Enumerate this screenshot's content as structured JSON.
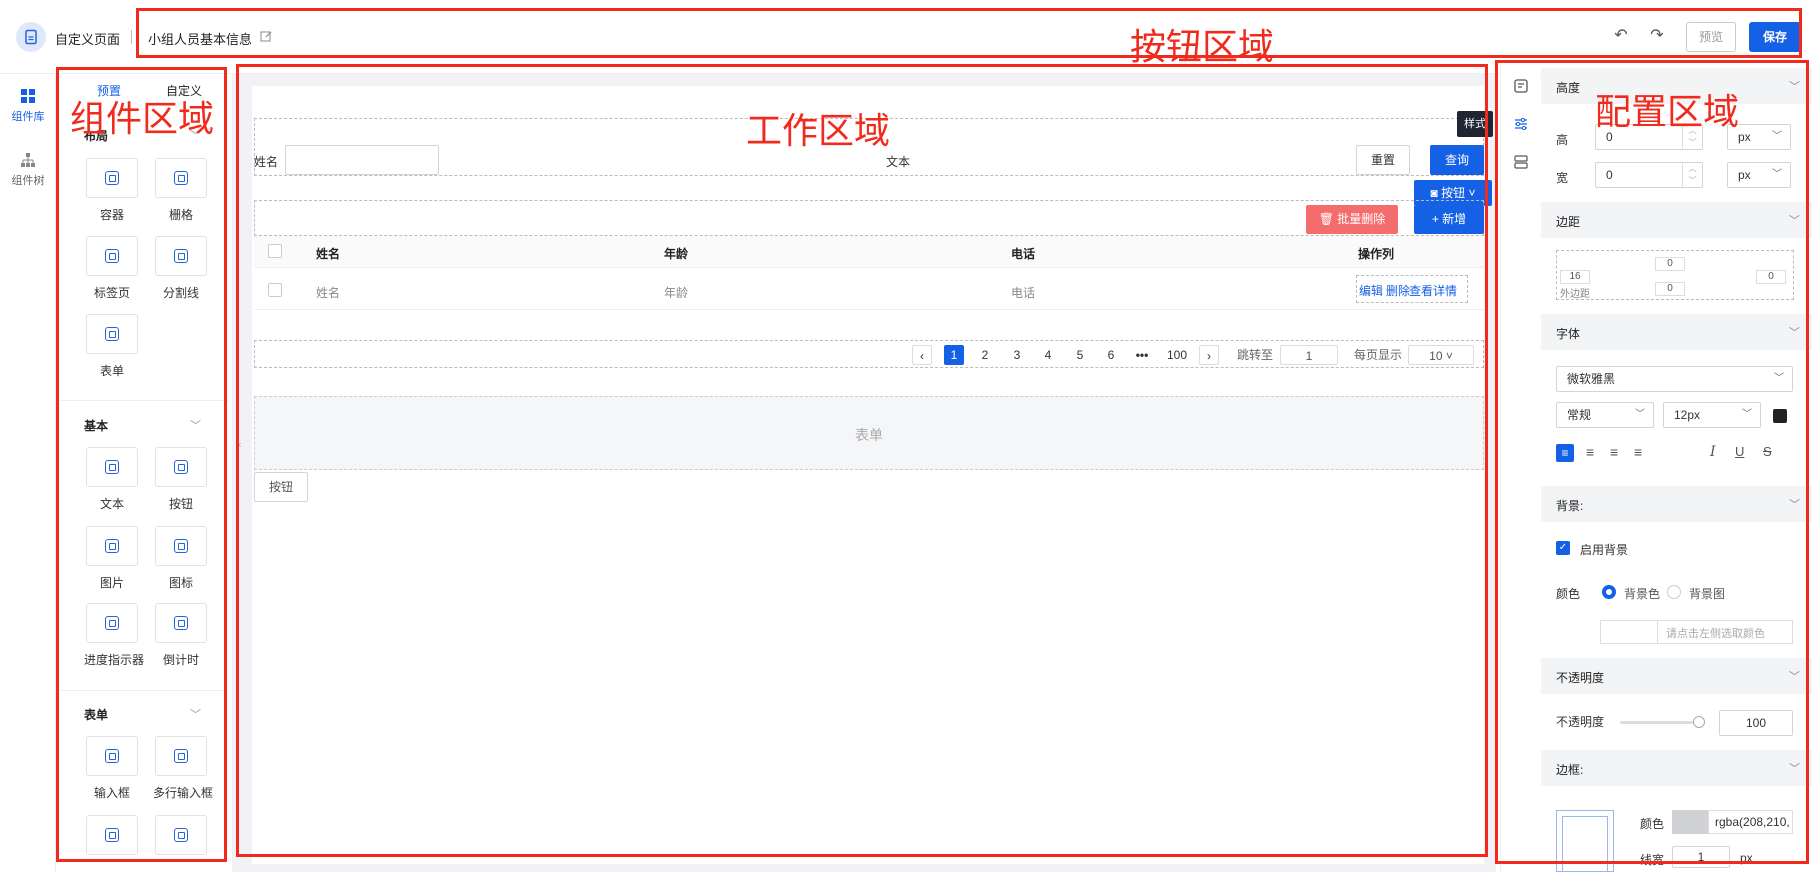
{
  "header": {
    "app_title": "自定义页面",
    "page_name": "小组人员基本信息",
    "preview_label": "预览",
    "save_label": "保存",
    "undo_icon": "undo-icon",
    "redo_icon": "redo-icon"
  },
  "rail": {
    "items": [
      {
        "label": "组件库",
        "icon": "grid-icon",
        "active": true
      },
      {
        "label": "组件树",
        "icon": "tree-icon",
        "active": false
      }
    ]
  },
  "component_panel": {
    "tabs": [
      {
        "label": "预置"
      },
      {
        "label": "自定义"
      }
    ],
    "groups": [
      {
        "title": "布局",
        "items": [
          {
            "label": "容器"
          },
          {
            "label": "栅格"
          },
          {
            "label": "标签页"
          },
          {
            "label": "分割线"
          },
          {
            "label": "表单"
          }
        ]
      },
      {
        "title": "基本",
        "items": [
          {
            "label": "文本"
          },
          {
            "label": "按钮"
          },
          {
            "label": "图片"
          },
          {
            "label": "图标"
          },
          {
            "label": "进度指示器"
          },
          {
            "label": "倒计时"
          }
        ]
      },
      {
        "title": "表单",
        "items": [
          {
            "label": "输入框"
          },
          {
            "label": "多行输入框"
          }
        ]
      }
    ]
  },
  "workspace": {
    "name_label": "姓名",
    "text_label": "文本",
    "reset_label": "重置",
    "query_label": "查询",
    "floating_tag": "样式",
    "button_dropdown_label": "按钮",
    "batch_delete_label": "批量删除",
    "add_label": "+ 新增",
    "table": {
      "headers": [
        "姓名",
        "年龄",
        "电话",
        "操作列"
      ],
      "row": [
        "姓名",
        "年龄",
        "电话"
      ],
      "actions": [
        "编辑",
        "删除",
        "查看详情"
      ]
    },
    "pagination": {
      "pages": [
        "1",
        "2",
        "3",
        "4",
        "5",
        "6",
        "•••",
        "100"
      ],
      "current": "1",
      "jump_label": "跳转至",
      "jump_value": "1",
      "per_page_label": "每页显示",
      "per_page_value": "10"
    },
    "form_placeholder": "表单",
    "button_label": "按钮"
  },
  "config": {
    "size_section": "高度",
    "height_label": "高",
    "height_value": "0",
    "width_label": "宽",
    "width_value": "0",
    "unit": "px",
    "margin_section": "边距",
    "margin_top": "0",
    "margin_right": "0",
    "margin_left": "16",
    "margin_inner": "0",
    "outer_margin_label": "外边距",
    "font_section": "字体",
    "font_family": "微软雅黑",
    "font_weight": "常规",
    "font_size": "12px",
    "background_section": "背景:",
    "enable_background_label": "启用背景",
    "color_label": "颜色",
    "bg_color_option": "背景色",
    "bg_image_option": "背景图",
    "color_picker_placeholder": "请点击左侧选取颜色",
    "opacity_section": "不透明度",
    "opacity_label": "不透明度",
    "opacity_value": "100",
    "border_section": "边框:",
    "border_color_label": "颜色",
    "border_color_value": "rgba(208,210,",
    "border_width_label": "线宽",
    "border_width_value": "1",
    "border_width_unit": "px"
  },
  "annotations": {
    "button_area": "按钮区域",
    "component_area": "组件区域",
    "work_area": "工作区域",
    "config_area": "配置区域"
  },
  "colors": {
    "primary": "#1461e6",
    "danger": "#f56c6c",
    "annotation": "#f02a1c"
  }
}
